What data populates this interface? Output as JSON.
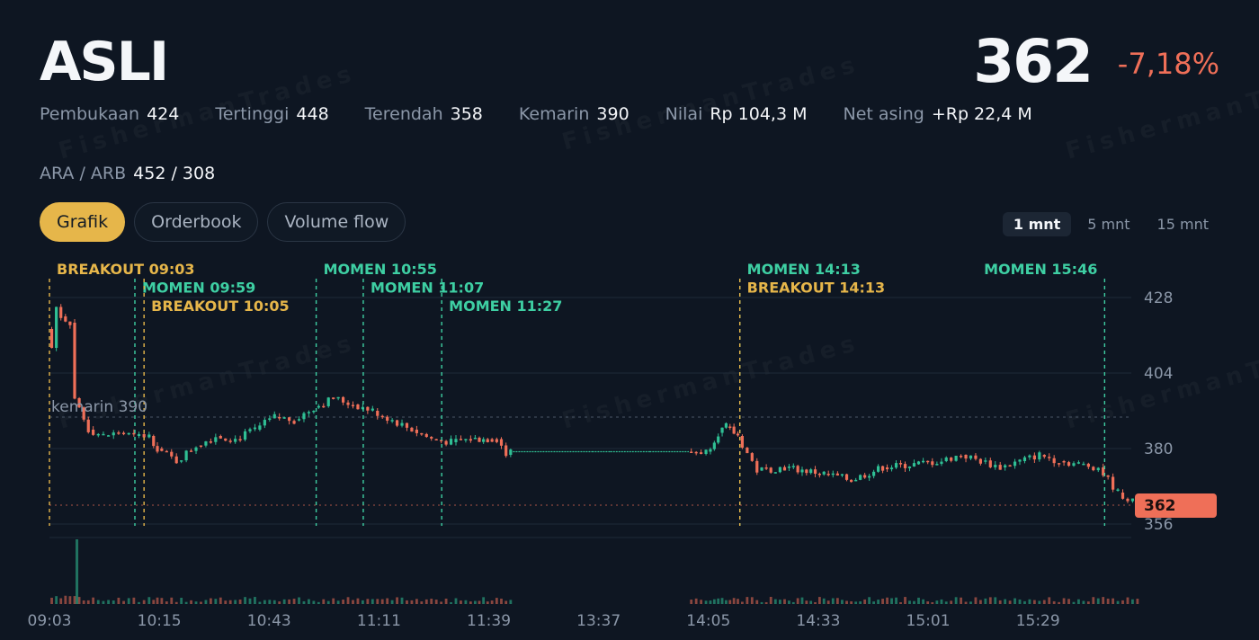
{
  "header": {
    "ticker": "ASLI",
    "price": "362",
    "change": "-7,18%"
  },
  "stats": [
    {
      "label": "Pembukaan",
      "value": "424"
    },
    {
      "label": "Tertinggi",
      "value": "448"
    },
    {
      "label": "Terendah",
      "value": "358"
    },
    {
      "label": "Kemarin",
      "value": "390"
    },
    {
      "label": "Nilai",
      "value": "Rp 104,3 M"
    },
    {
      "label": "Net asing",
      "value": "+Rp 22,4 M"
    }
  ],
  "limits": {
    "label": "ARA / ARB",
    "value": "452 / 308"
  },
  "tabs": [
    {
      "label": "Grafik",
      "active": true
    },
    {
      "label": "Orderbook",
      "active": false
    },
    {
      "label": "Volume flow",
      "active": false
    }
  ],
  "timeframes": [
    {
      "label": "1 mnt",
      "active": true
    },
    {
      "label": "5 mnt",
      "active": false
    },
    {
      "label": "15 mnt",
      "active": false
    }
  ],
  "watermark": "FishermanTrades",
  "colors": {
    "up": "#2fbf94",
    "down": "#ef6f58",
    "breakout": "#e6b64a",
    "momen": "#3ecfa3",
    "accent": "#e6b64a",
    "background": "#0e1622"
  },
  "chart_data": {
    "type": "candlestick",
    "y_ticks": [
      "428",
      "404",
      "380",
      "356"
    ],
    "ylim": [
      352,
      434
    ],
    "x_ticks": [
      "09:03",
      "10:15",
      "10:43",
      "11:11",
      "11:39",
      "13:37",
      "14:05",
      "14:33",
      "15:01",
      "15:29"
    ],
    "prev_close": {
      "label": "kemarin 390",
      "value": 390
    },
    "last_price": {
      "label": "362",
      "value": 362
    },
    "events": [
      {
        "label": "BREAKOUT 09:03",
        "time": "09:03",
        "kind": "breakout"
      },
      {
        "label": "MOMEN 09:59",
        "time": "09:59",
        "kind": "momen"
      },
      {
        "label": "BREAKOUT 10:05",
        "time": "10:05",
        "kind": "breakout"
      },
      {
        "label": "MOMEN 10:55",
        "time": "10:55",
        "kind": "momen"
      },
      {
        "label": "MOMEN 11:07",
        "time": "11:07",
        "kind": "momen"
      },
      {
        "label": "MOMEN 11:27",
        "time": "11:27",
        "kind": "momen"
      },
      {
        "label": "MOMEN 14:13",
        "time": "14:13",
        "kind": "momen"
      },
      {
        "label": "BREAKOUT 14:13",
        "time": "14:13",
        "kind": "breakout"
      },
      {
        "label": "MOMEN 15:46",
        "time": "15:46",
        "kind": "momen"
      }
    ],
    "price_path": [
      [
        "09:03",
        418
      ],
      [
        "09:06",
        412
      ],
      [
        "09:09",
        425
      ],
      [
        "09:12",
        422
      ],
      [
        "09:18",
        420
      ],
      [
        "09:21",
        396
      ],
      [
        "09:30",
        386
      ],
      [
        "09:40",
        384
      ],
      [
        "09:50",
        385
      ],
      [
        "10:00",
        384
      ],
      [
        "10:10",
        384
      ],
      [
        "10:15",
        380
      ],
      [
        "10:20",
        376
      ],
      [
        "10:25",
        381
      ],
      [
        "10:30",
        384
      ],
      [
        "10:35",
        383
      ],
      [
        "10:40",
        386
      ],
      [
        "10:45",
        390
      ],
      [
        "10:50",
        389
      ],
      [
        "10:55",
        393
      ],
      [
        "11:00",
        396
      ],
      [
        "11:05",
        394
      ],
      [
        "11:10",
        392
      ],
      [
        "11:15",
        389
      ],
      [
        "11:20",
        386
      ],
      [
        "11:25",
        383
      ],
      [
        "11:30",
        382
      ],
      [
        "11:35",
        383
      ],
      [
        "11:40",
        383
      ],
      [
        "11:45",
        383
      ],
      [
        "11:50",
        383
      ],
      [
        "11:55",
        381
      ],
      [
        "12:00",
        378
      ],
      [
        "12:05",
        379
      ],
      [
        "13:30",
        379
      ],
      [
        "13:40",
        379
      ],
      [
        "13:50",
        379
      ],
      [
        "14:00",
        379
      ],
      [
        "14:05",
        379
      ],
      [
        "14:08",
        385
      ],
      [
        "14:10",
        387
      ],
      [
        "14:13",
        384
      ],
      [
        "14:18",
        373
      ],
      [
        "14:25",
        374
      ],
      [
        "14:35",
        372
      ],
      [
        "14:42",
        370
      ],
      [
        "14:50",
        374
      ],
      [
        "14:58",
        375
      ],
      [
        "15:05",
        376
      ],
      [
        "15:10",
        378
      ],
      [
        "15:15",
        376
      ],
      [
        "15:20",
        374
      ],
      [
        "15:25",
        376
      ],
      [
        "15:30",
        378
      ],
      [
        "15:35",
        376
      ],
      [
        "15:40",
        375
      ],
      [
        "15:45",
        374
      ],
      [
        "15:50",
        366
      ],
      [
        "15:55",
        362
      ]
    ]
  }
}
